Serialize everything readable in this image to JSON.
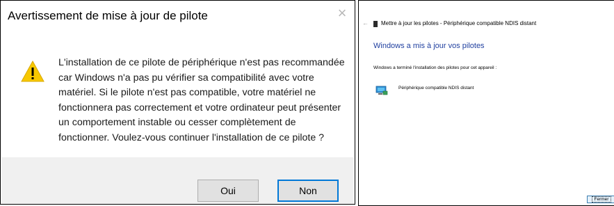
{
  "warning_dialog": {
    "title": "Avertissement de mise à jour de pilote",
    "message": "L'installation de ce pilote de périphérique n'est pas recommandée car Windows n'a pas pu vérifier sa compatibilité avec votre matériel. Si le pilote n'est pas compatible, votre matériel ne fonctionnera pas correctement et votre ordinateur peut présenter un comportement instable ou cesser complètement de fonctionner. Voulez-vous continuer l'installation de ce pilote ?",
    "yes_label": "Oui",
    "no_label": "Non",
    "icons": {
      "warning": "warning-triangle-icon",
      "close": "close-icon"
    }
  },
  "update_wizard": {
    "header_title": "Mettre à jour les pilotes - Périphérique compatible NDIS distant",
    "heading": "Windows a mis à jour vos pilotes",
    "description": "Windows a terminé l'installation des pilotes pour cet appareil :",
    "device_name": "Périphérique compatible NDIS distant",
    "close_label": "Fermer",
    "icons": {
      "back": "back-arrow-icon",
      "device": "network-adapter-icon"
    }
  },
  "colors": {
    "warning_yellow": "#f7c800",
    "heading_blue": "#1f3f9f",
    "focus_blue": "#0078d7",
    "footer_gray": "#f0f0f0"
  }
}
